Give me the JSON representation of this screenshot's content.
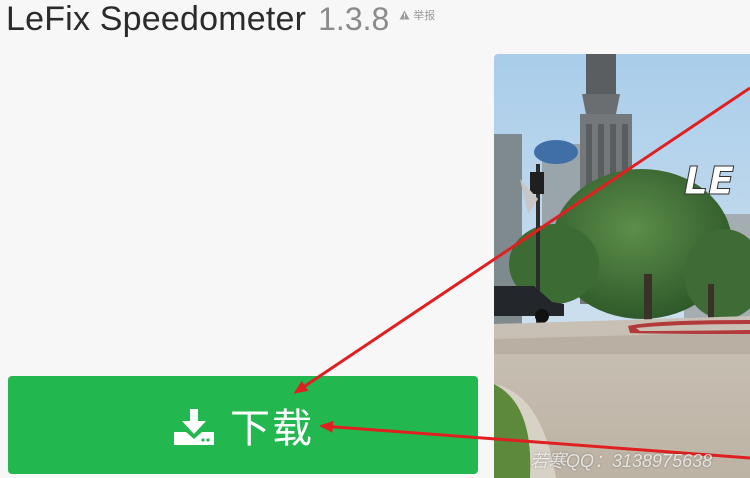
{
  "app": {
    "name": "LeFix Speedometer",
    "version": "1.3.8",
    "report_label": "举报"
  },
  "download": {
    "label": "下载"
  },
  "screenshot": {
    "logo_text": "LE"
  },
  "watermark": {
    "text": "若寒QQ：3138975638"
  },
  "colors": {
    "download_button": "#22b84f",
    "annotation_arrow": "#e02020",
    "title_text": "#2b2b2b",
    "version_text": "#8b8b8b"
  },
  "icons": {
    "report": "warning-triangle-icon",
    "download": "download-tray-icon"
  }
}
